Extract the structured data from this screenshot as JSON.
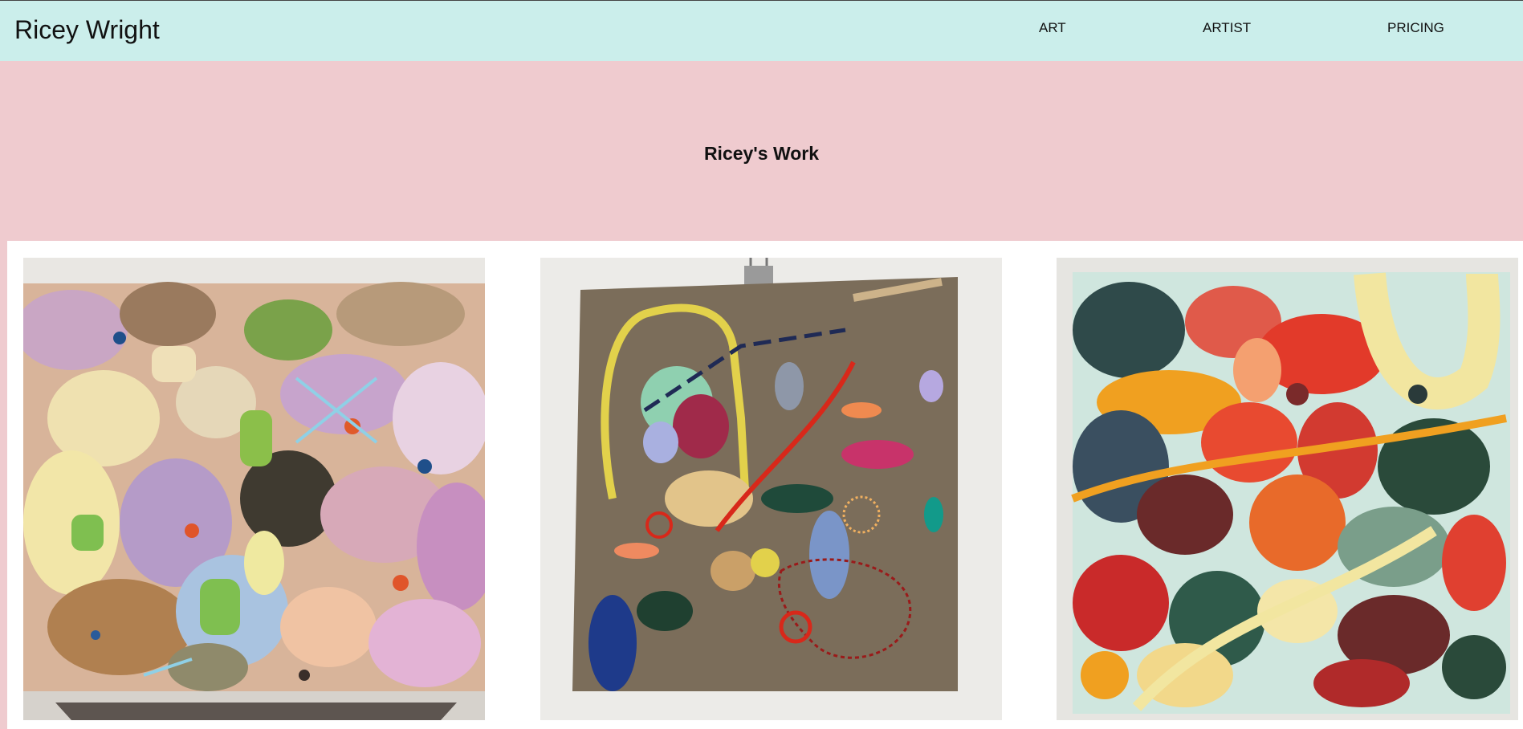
{
  "header": {
    "brand": "Ricey Wright",
    "nav": [
      "ART",
      "ARTIST",
      "PRICING"
    ]
  },
  "hero": {
    "title": "Ricey's Work"
  },
  "gallery": {
    "images": [
      {
        "name": "abstract-painting-pastel"
      },
      {
        "name": "embroidery-on-burlap"
      },
      {
        "name": "abstract-painting-bold"
      }
    ]
  },
  "colors": {
    "topbar": "#cbeeeb",
    "hero": "#efcbcf",
    "text": "#111111"
  }
}
